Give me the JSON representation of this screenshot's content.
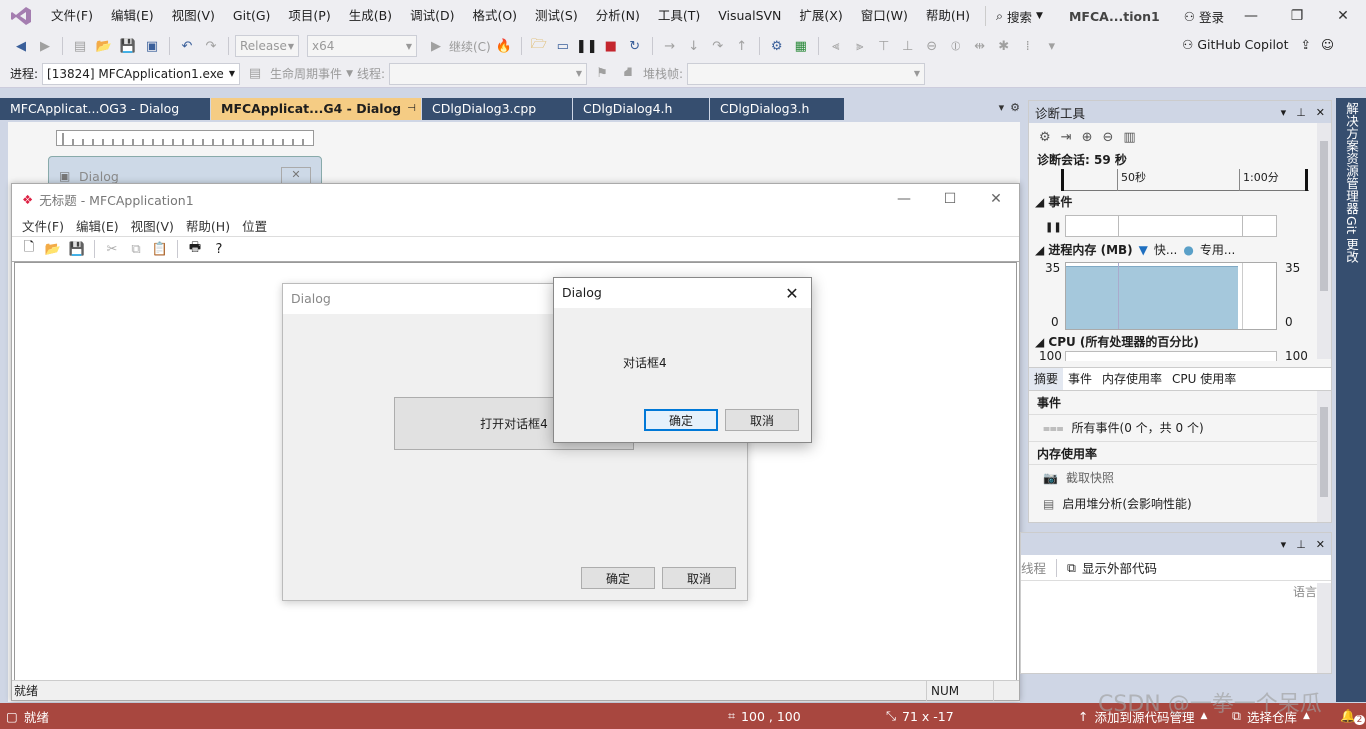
{
  "vs": {
    "menu": [
      "文件(F)",
      "编辑(E)",
      "视图(V)",
      "Git(G)",
      "项目(P)",
      "生成(B)",
      "调试(D)",
      "格式(O)",
      "测试(S)",
      "分析(N)",
      "工具(T)",
      "VisualSVN",
      "扩展(X)",
      "窗口(W)",
      "帮助(H)"
    ],
    "search": "搜索",
    "solution": "MFCA...tion1",
    "login": "登录",
    "config": "Release",
    "platform": "x64",
    "continue": "继续(C)",
    "process_label": "进程:",
    "process_value": "[13824] MFCApplication1.exe",
    "lifecycle": "生命周期事件",
    "thread_label": "线程:",
    "stack_label": "堆栈帧:",
    "copilot": "GitHub Copilot"
  },
  "tabs": [
    {
      "label": "MFCApplicat...OG3 - Dialog",
      "active": false
    },
    {
      "label": "MFCApplicat...G4 - Dialog",
      "active": true
    },
    {
      "label": "CDlgDialog3.cpp",
      "active": false
    },
    {
      "label": "CDlgDialog4.h",
      "active": false
    },
    {
      "label": "CDlgDialog3.h",
      "active": false
    }
  ],
  "editor": {
    "preview_title": "Dialog"
  },
  "app": {
    "title": "无标题 - MFCApplication1",
    "menu": [
      "文件(F)",
      "编辑(E)",
      "视图(V)",
      "帮助(H)",
      "位置"
    ],
    "status": "就绪",
    "status_num": "NUM"
  },
  "dialog_bg": {
    "title": "Dialog",
    "open_btn": "打开对话框4",
    "ok": "确定",
    "cancel": "取消"
  },
  "dialog4": {
    "title": "Dialog",
    "text": "对话框4",
    "ok": "确定",
    "cancel": "取消"
  },
  "diag": {
    "title": "诊断工具",
    "session": "诊断会话: 59 秒",
    "tick1": "50秒",
    "tick2": "1:00分",
    "events": "事件",
    "memory": "进程内存 (MB)",
    "legend_fast": "快...",
    "legend_private": "专用...",
    "mem_max": "35",
    "mem_min": "0",
    "mem_level": 0.95,
    "cpu": "CPU (所有处理器的百分比)",
    "cpu_max": "100",
    "tabs": [
      "摘要",
      "事件",
      "内存使用率",
      "CPU 使用率"
    ],
    "events_head": "事件",
    "all_events": "所有事件(0 个，共 0 个)",
    "mem_usage_head": "内存使用率",
    "snapshot": "截取快照",
    "heap": "启用堆分析(会影响性能)"
  },
  "bottom_panel": {
    "thread": "线程",
    "external": "显示外部代码",
    "lang": "语言"
  },
  "side": [
    "解决方案资源管理器",
    "Git 更改"
  ],
  "statusbar": {
    "ready": "就绪",
    "pos": "100 , 100",
    "size": "71 x -17",
    "source": "添加到源代码管理",
    "repo": "选择仓库",
    "notify": "2"
  },
  "watermark": "CSDN @一拳一个呆瓜",
  "colors": {
    "statusbar": "#a8473f",
    "tab_active": "#f5cc84",
    "tab_inactive": "#364e6f"
  }
}
